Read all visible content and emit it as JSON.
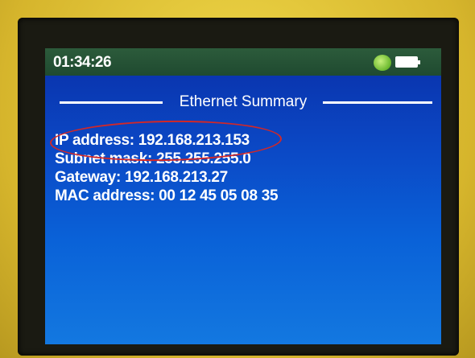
{
  "status_bar": {
    "time": "01:34:26",
    "status_icon": "network-status-icon",
    "battery_icon": "battery-icon"
  },
  "screen": {
    "title": "Ethernet Summary",
    "lines": [
      "IP address: 192.168.213.153",
      "Subnet mask: 255.255.255.0",
      "Gateway: 192.168.213.27",
      "MAC address: 00 12 45 05 08 35"
    ]
  },
  "colors": {
    "screen_blue": "#0b49c6",
    "status_green": "#2c5b3b",
    "highlight_red": "#d22828",
    "device_yellow": "#e2c93a"
  }
}
